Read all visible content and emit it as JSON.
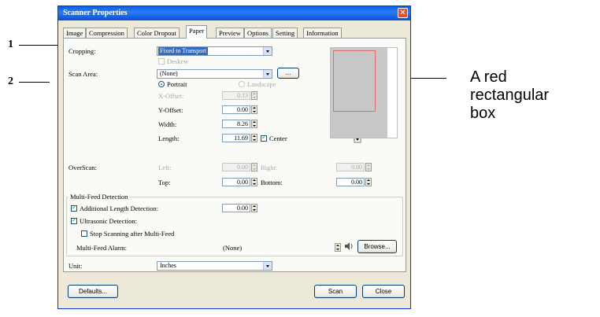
{
  "window": {
    "title": "Scanner Properties",
    "close_glyph": "✕"
  },
  "tabs": [
    "Image",
    "Compression",
    "Color Dropout",
    "Paper",
    "Preview",
    "Options",
    "Setting",
    "Information"
  ],
  "cropping": {
    "label": "Cropping:",
    "value": "Fixed to Transport",
    "deskew_label": "Deskew"
  },
  "scan_area": {
    "label": "Scan Area:",
    "value": "(None)",
    "browse_label": "...",
    "portrait_label": "Portrait",
    "landscape_label": "Landscape"
  },
  "offsets": {
    "x_label": "X-Offset:",
    "x_value": "0.13",
    "y_label": "Y-Offset:",
    "y_value": "0.00",
    "width_label": "Width:",
    "width_value": "8.26",
    "length_label": "Length:",
    "length_value": "11.69",
    "center_label": "Center"
  },
  "overscan": {
    "label": "OverScan:",
    "left_label": "Left:",
    "left_value": "0.00",
    "right_label": "Right:",
    "right_value": "0.00",
    "top_label": "Top:",
    "top_value": "0.00",
    "bottom_label": "Bottom:",
    "bottom_value": "0.00"
  },
  "multifeed": {
    "group_label": "Multi-Feed Detection",
    "length_label": "Additional Length Detection:",
    "length_value": "0.00",
    "ultrasonic_label": "Ultrasonic Detection:",
    "stop_label": "Stop Scanning after Multi-Feed",
    "alarm_label": "Multi-Feed Alarm:",
    "alarm_value": "(None)",
    "browse_label": "Browse..."
  },
  "unit": {
    "label": "Unit:",
    "value": "Inches"
  },
  "buttons": {
    "defaults": "Defaults...",
    "scan": "Scan",
    "close": "Close"
  },
  "annotations": {
    "one": "1",
    "two": "2",
    "callout_line1": "A red",
    "callout_line2": "rectangular",
    "callout_line3": "box"
  },
  "colors": {
    "title_bar": "#0a5fe8",
    "selection": "#316ac5",
    "preview_frame": "#e36a6a"
  }
}
